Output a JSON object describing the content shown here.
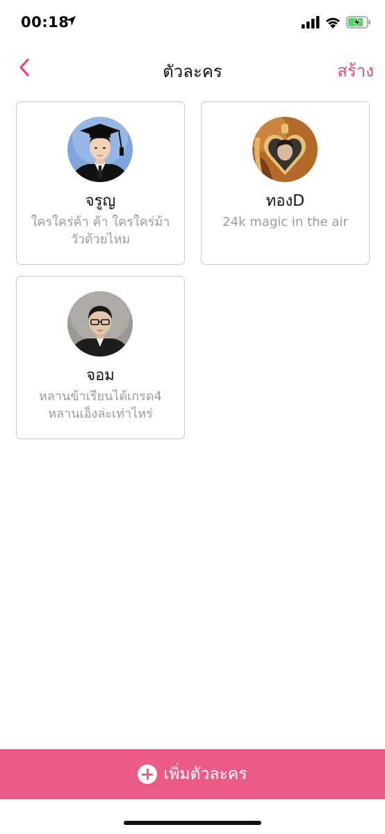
{
  "status_bar": {
    "time": "00:18",
    "location_icon": "location-arrow-icon",
    "signal_icon": "cellular-signal-icon",
    "wifi_icon": "wifi-icon",
    "battery_icon": "battery-charging-icon",
    "battery_color": "#4cd964"
  },
  "nav": {
    "back_icon": "chevron-left-icon",
    "title": "ตัวละคร",
    "action_label": "สร้าง",
    "accent_color": "#e9477b"
  },
  "characters": [
    {
      "name": "จรูญ",
      "description_lines": [
        "ใครใคร่ค้า ค้า ใครใคร่ม้า",
        "วัวด้วยไหม"
      ],
      "avatar": "graduation-portrait-avatar"
    },
    {
      "name": "ทองD",
      "description_lines": [
        "24k magic in the air",
        ""
      ],
      "avatar": "heart-locket-avatar"
    },
    {
      "name": "จอม",
      "description_lines": [
        "หลานข้าเรียนได้เกรด4",
        "หลานเอ็งล่ะเท่าไหร่"
      ],
      "avatar": "glasses-portrait-avatar"
    }
  ],
  "add_button": {
    "label": "เพิ่มตัวละคร",
    "icon": "plus-circle-icon",
    "color": "#ec5b88"
  }
}
